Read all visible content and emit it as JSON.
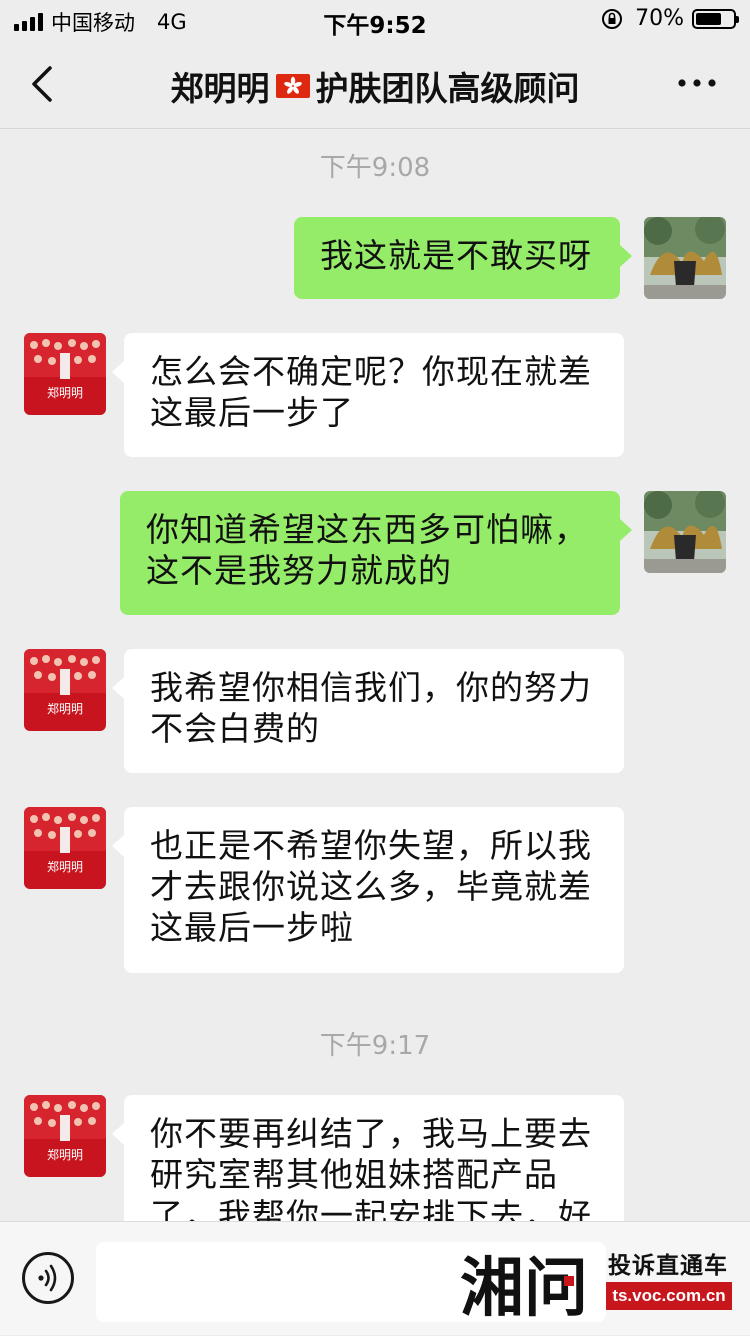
{
  "status_bar": {
    "carrier": "中国移动",
    "network": "4G",
    "time": "下午9:52",
    "battery_percent": "70%",
    "battery_level": 0.7
  },
  "nav": {
    "title_name": "郑明明",
    "title_role": "护肤团队高级顾问"
  },
  "chat": {
    "timestamps": [
      "下午9:08",
      "下午9:17"
    ],
    "messages": [
      {
        "from": "me",
        "text": "我这就是不敢买呀"
      },
      {
        "from": "other",
        "lines": [
          "怎么会不确定呢？你现在就差",
          "这最后一步了"
        ]
      },
      {
        "from": "me",
        "lines": [
          "你知道希望这东西多可怕嘛，",
          "这不是我努力就成的"
        ]
      },
      {
        "from": "other",
        "lines": [
          "我希望你相信我们，你的努力",
          "不会白费的"
        ]
      },
      {
        "from": "other",
        "lines": [
          "也正是不希望你失望，所以我",
          "才去跟你说这么多，毕竟就差",
          "这最后一步啦"
        ]
      },
      {
        "from": "other",
        "lines": [
          "你不要再纠结了，我马上要去",
          "研究室帮其他姐妹搭配产品",
          "了，我帮你一起安排下去，好"
        ]
      }
    ]
  },
  "avatar_text": "郑明明",
  "watermark": {
    "logo": "湘问",
    "title": "投诉直通车",
    "url": "ts.voc.com.cn"
  },
  "colors": {
    "background": "#ededed",
    "bubble_out": "#95ec69",
    "bubble_in": "#ffffff",
    "watermark_red": "#c8161d"
  }
}
